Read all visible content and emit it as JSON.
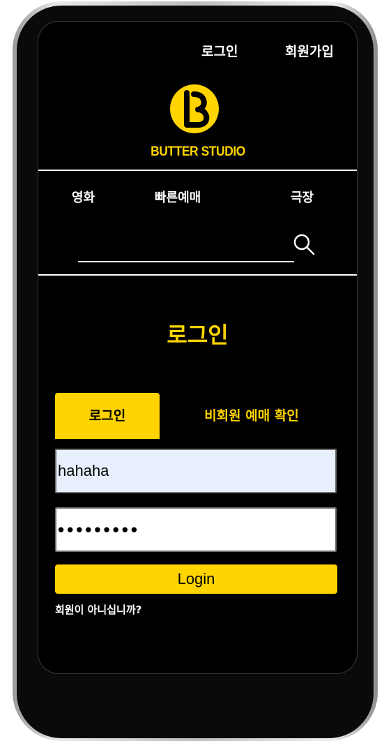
{
  "header": {
    "login_link": "로그인",
    "signup_link": "회원가입",
    "logo_text": "BUTTER STUDIO"
  },
  "nav": {
    "items": [
      {
        "label": "영화"
      },
      {
        "label": "빠른예매"
      },
      {
        "label": "극장"
      }
    ]
  },
  "search": {
    "value": "",
    "placeholder": ""
  },
  "main": {
    "title": "로그인",
    "tabs": [
      {
        "label": "로그인",
        "active": true
      },
      {
        "label": "비회원 예매 확인",
        "active": false
      }
    ],
    "id_field": {
      "value": "hahaha"
    },
    "password_field": {
      "value": "•••••••••"
    },
    "login_button": "Login",
    "register_prompt": "회원이 아니십니까?"
  },
  "colors": {
    "accent": "#ffd400",
    "background": "#000000",
    "text": "#ffffff",
    "autofill": "#e8f0fe"
  },
  "icons": {
    "search": "search-icon",
    "logo": "butter-logo-icon"
  }
}
